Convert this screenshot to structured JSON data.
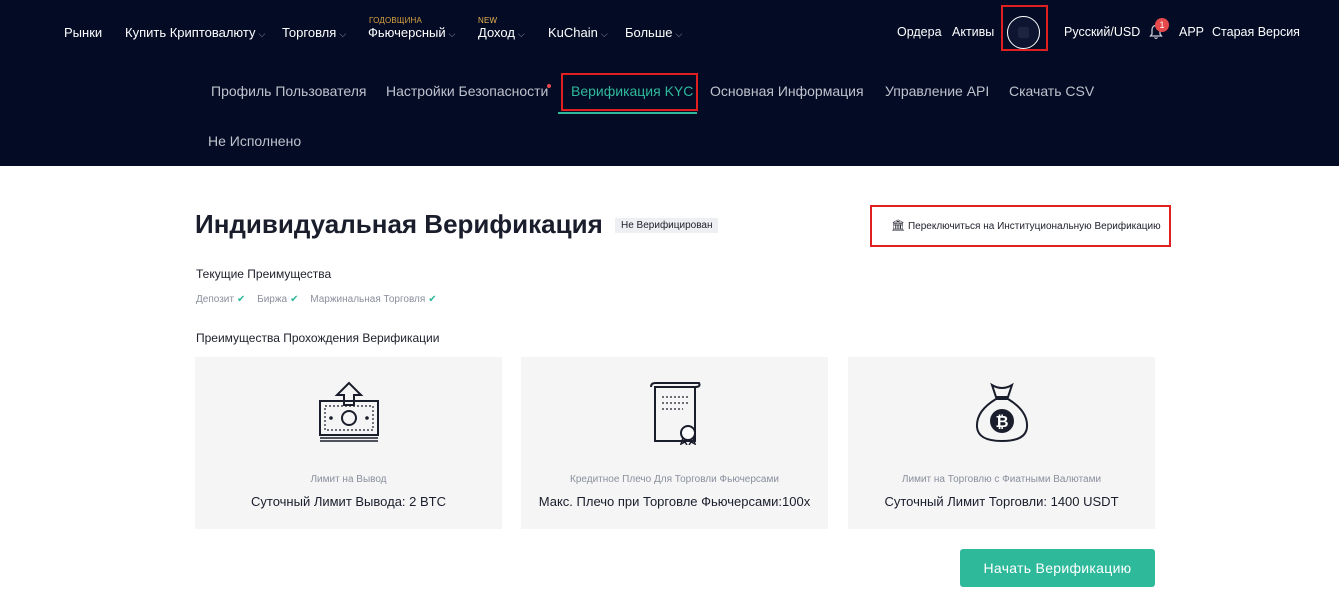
{
  "nav": {
    "items": [
      {
        "label": "Рынки",
        "dropdown": false
      },
      {
        "label": "Купить Криптовалюту",
        "dropdown": true
      },
      {
        "label": "Торговля",
        "dropdown": true
      },
      {
        "label": "Фьючерсный",
        "dropdown": true,
        "badge": "ГОДОВЩИНА"
      },
      {
        "label": "Доход",
        "dropdown": true,
        "badge": "NEW"
      },
      {
        "label": "KuChain",
        "dropdown": true
      },
      {
        "label": "Больше",
        "dropdown": true
      }
    ],
    "right": {
      "orders": "Ордера",
      "assets": "Активы",
      "language": "Русский/USD",
      "notification_count": "1",
      "app": "APP",
      "old_version": "Старая Версия"
    }
  },
  "account_tabs": [
    {
      "label": "Профиль Пользователя",
      "active": false
    },
    {
      "label": "Настройки Безопасности",
      "active": false,
      "dot": true
    },
    {
      "label": "Верификация KYC",
      "active": true
    },
    {
      "label": "Основная Информация",
      "active": false
    },
    {
      "label": "Управление API",
      "active": false
    },
    {
      "label": "Скачать CSV",
      "active": false
    },
    {
      "label": "Не Исполнено",
      "active": false
    }
  ],
  "main": {
    "title": "Индивидуальная Верификация",
    "status": "Не Верифицирован",
    "switch_link": "Переключиться на Институциональную Верификацию",
    "current_benefits_title": "Текущие Преимущества",
    "current_benefits": [
      "Депозит",
      "Биржа",
      "Маржинальная Торговля"
    ],
    "pass_benefits_title": "Преимущества Прохождения Верификации",
    "cards": [
      {
        "icon": "money-upload-icon",
        "sub": "Лимит на Вывод",
        "main": "Суточный Лимит Вывода: 2 BTC"
      },
      {
        "icon": "certificate-icon",
        "sub": "Кредитное Плечо Для Торговли Фьючерсами",
        "main": "Макс. Плечо при Торговле Фьючерсами:100x"
      },
      {
        "icon": "bitcoin-bag-icon",
        "sub": "Лимит на Торговлю с Фиатными Валютами",
        "main": "Суточный Лимит Торговли: 1400 USDT"
      }
    ],
    "start_button": "Начать Верификацию"
  },
  "colors": {
    "header_bg": "#040b25",
    "accent": "#2eb99b",
    "highlight_border": "#e02020",
    "notification": "#e5494b"
  }
}
